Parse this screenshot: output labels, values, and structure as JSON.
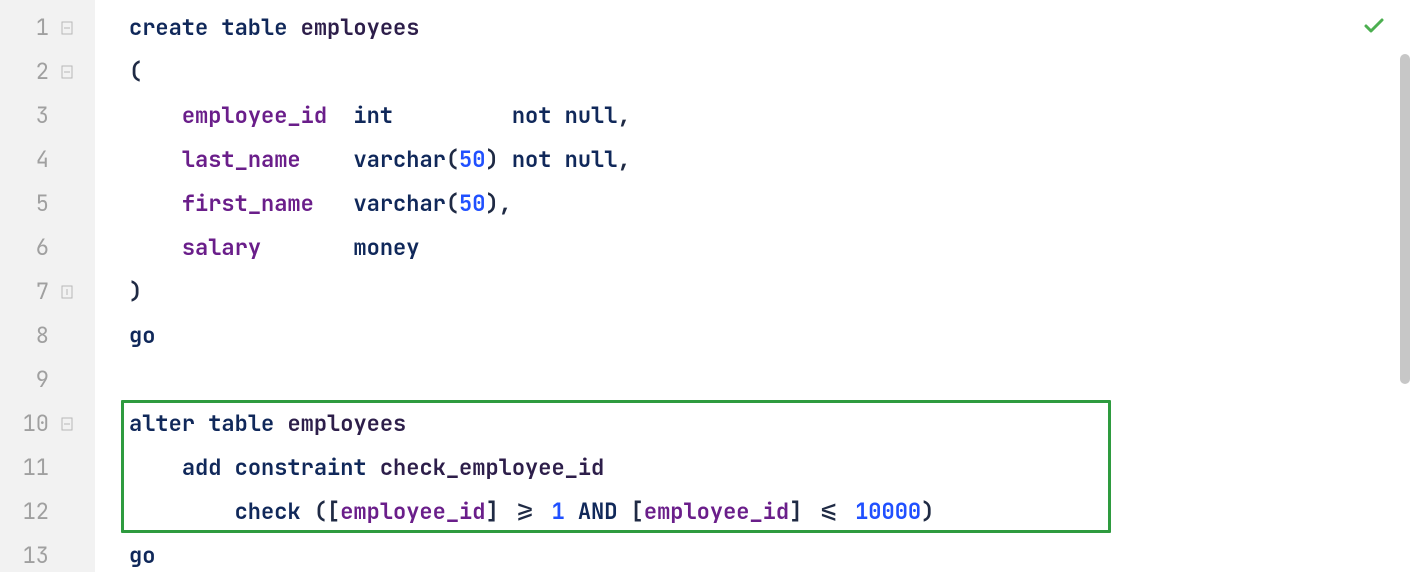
{
  "gutter": {
    "lines": [
      "1",
      "2",
      "3",
      "4",
      "5",
      "6",
      "7",
      "8",
      "9",
      "10",
      "11",
      "12",
      "13"
    ],
    "fold_markers": [
      1,
      2,
      7,
      10
    ]
  },
  "code": {
    "line1": {
      "kw_create": "create",
      "kw_table": "table",
      "ident": "employees"
    },
    "line2": {
      "paren": "("
    },
    "line3": {
      "field": "employee_id",
      "type": "int",
      "nn": "not null",
      "comma": ","
    },
    "line4": {
      "field": "last_name",
      "type": "varchar",
      "lp": "(",
      "num": "50",
      "rp": ")",
      "nn": "not null",
      "comma": ","
    },
    "line5": {
      "field": "first_name",
      "type": "varchar",
      "lp": "(",
      "num": "50",
      "rp": ")",
      "comma": ","
    },
    "line6": {
      "field": "salary",
      "type": "money"
    },
    "line7": {
      "paren": ")"
    },
    "line8": {
      "kw": "go"
    },
    "line9": {
      "blank": ""
    },
    "line10": {
      "kw_alter": "alter",
      "kw_table": "table",
      "ident": "employees"
    },
    "line11": {
      "kw_add": "add",
      "kw_constraint": "constraint",
      "ident": "check_employee_id"
    },
    "line12": {
      "kw_check": "check",
      "lp1": "(",
      "lb1": "[",
      "f1": "employee_id",
      "rb1": "]",
      "op1": ">=",
      "n1": "1",
      "and": "AND",
      "lb2": "[",
      "f2": "employee_id",
      "rb2": "]",
      "op2": "<=",
      "n2": "10000",
      "rp1": ")"
    },
    "line13": {
      "kw": "go"
    }
  },
  "highlight": {
    "visible": true
  },
  "status": {
    "ok": true
  }
}
